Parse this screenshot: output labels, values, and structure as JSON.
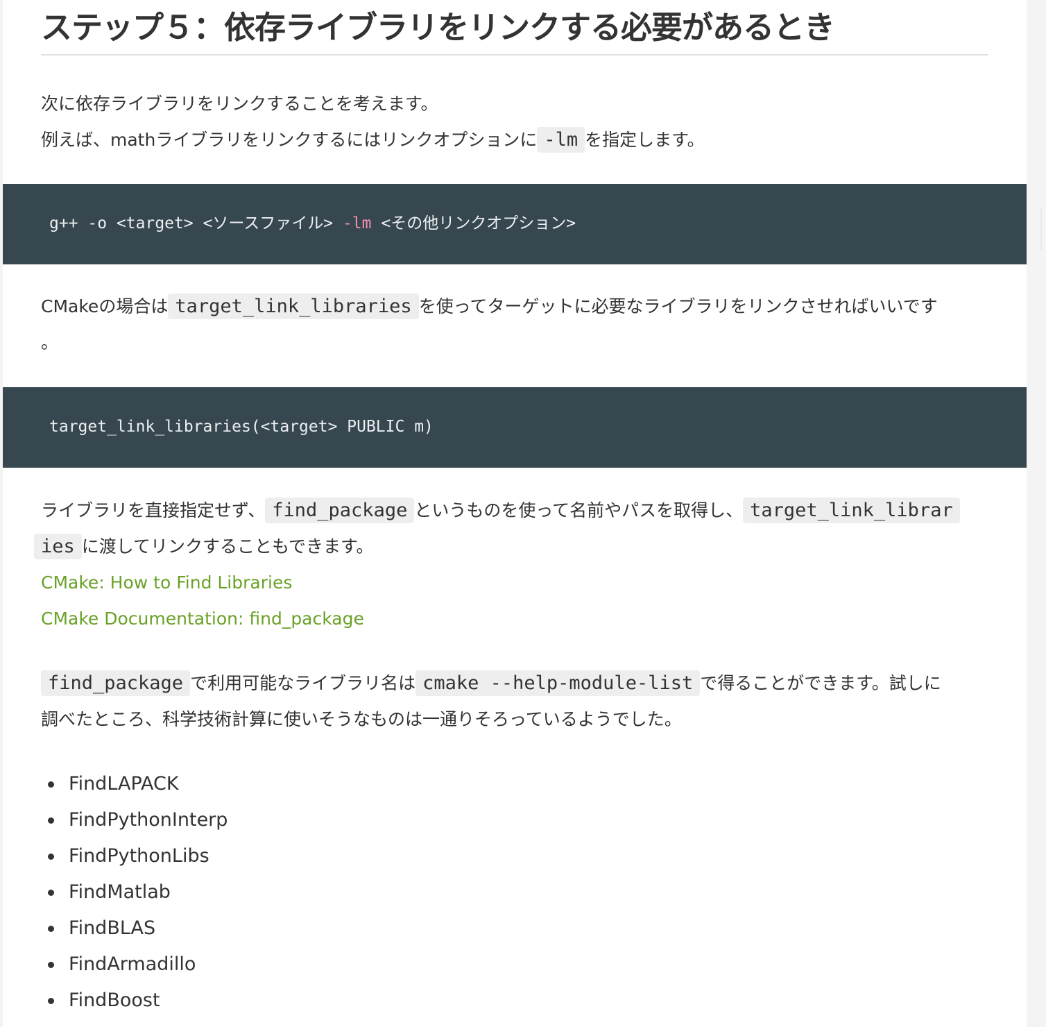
{
  "heading": "ステップ５：依存ライブラリをリンクする必要があるとき",
  "intro": {
    "line1": "次に依存ライブラリをリンクすることを考えます。",
    "line2_before": "例えば、mathライブラリをリンクするにはリンクオプションに",
    "line2_code": "-lm",
    "line2_after": "を指定します。"
  },
  "code1": {
    "before": "g++ -o <target> <ソースファイル> ",
    "highlight": "-lm",
    "after": " <その他リンクオプション>"
  },
  "cmake_para": {
    "before": "CMakeの場合は",
    "code": "target_link_libraries",
    "after": "を使ってターゲットに必要なライブラリをリンクさせればいいです",
    "wrap": "。"
  },
  "code2": "target_link_libraries(<target> PUBLIC m)",
  "find_para": {
    "before": "ライブラリを直接指定せず、",
    "code1": "find_package",
    "middle": "というものを使って名前やパスを取得し、",
    "code2_part1": "target_link_librar",
    "code2_part2": "ies",
    "after": "に渡してリンクすることもできます。"
  },
  "links": [
    "CMake: How to Find Libraries",
    "CMake Documentation: find_package"
  ],
  "module_para": {
    "code1": "find_package",
    "text1": "で利用可能なライブラリ名は",
    "code2": "cmake --help-module-list",
    "text2": "で得ることができます。試しに",
    "line2": "調べたところ、科学技術計算に使いそうなものは一通りそろっているようでした。"
  },
  "modules": [
    "FindLAPACK",
    "FindPythonInterp",
    "FindPythonLibs",
    "FindMatlab",
    "FindBLAS",
    "FindArmadillo",
    "FindBoost"
  ],
  "colors": {
    "code_background": "#37474f",
    "link": "#6aa228",
    "highlight": "#f48fb1"
  }
}
